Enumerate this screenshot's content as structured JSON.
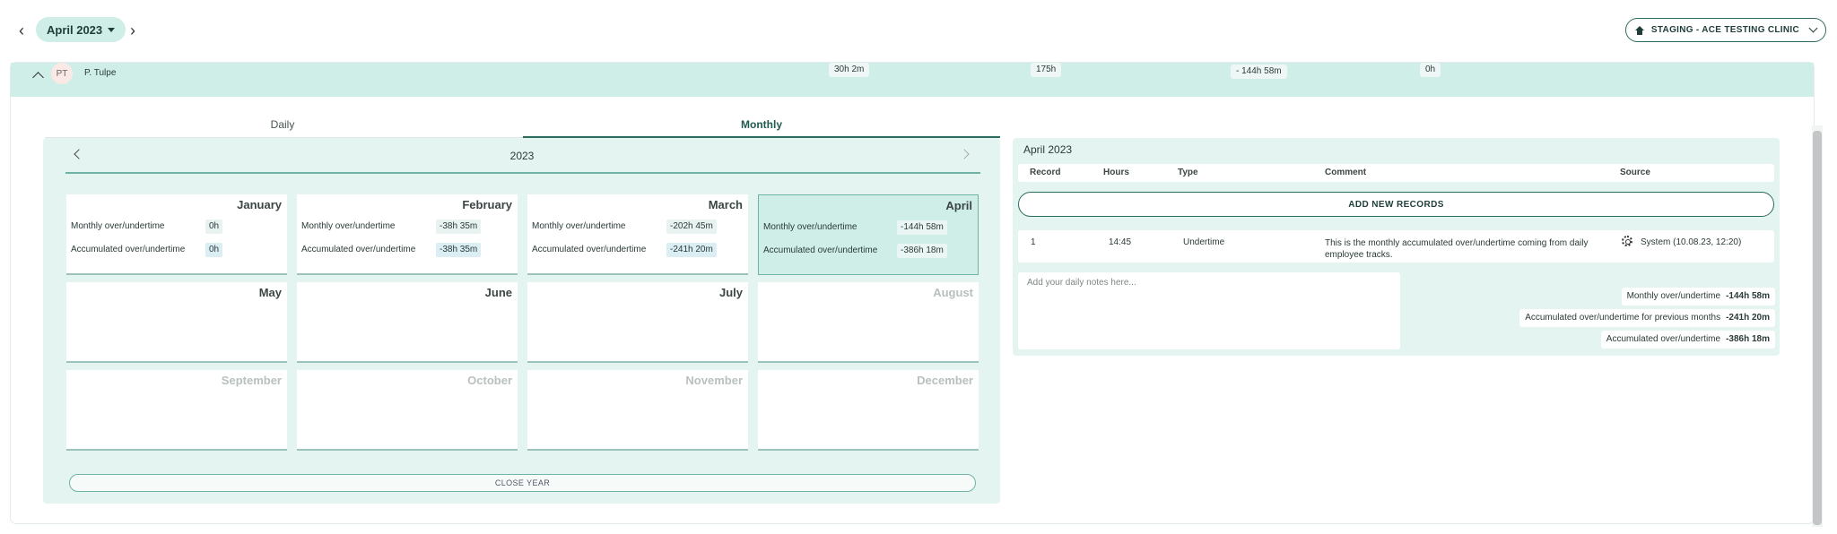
{
  "topbar": {
    "month_label": "April 2023",
    "clinic_label": "STAGING - ACE TESTING CLINIC"
  },
  "person": {
    "initials": "PT",
    "name": "P. Tulpe",
    "stats": [
      "30h 2m",
      "175h",
      "- 144h 58m",
      "0h"
    ]
  },
  "tabs": {
    "daily": "Daily",
    "monthly": "Monthly"
  },
  "year_view": {
    "year": "2023",
    "monthly_label": "Monthly over/undertime",
    "accum_label": "Accumulated over/undertime",
    "months": [
      {
        "name": "January",
        "monthly": "0h",
        "accum": "0h"
      },
      {
        "name": "February",
        "monthly": "-38h 35m",
        "accum": "-38h 35m"
      },
      {
        "name": "March",
        "monthly": "-202h 45m",
        "accum": "-241h 20m"
      },
      {
        "name": "April",
        "monthly": "-144h 58m",
        "accum": "-386h 18m"
      },
      {
        "name": "May"
      },
      {
        "name": "June"
      },
      {
        "name": "July"
      },
      {
        "name": "August"
      },
      {
        "name": "September"
      },
      {
        "name": "October"
      },
      {
        "name": "November"
      },
      {
        "name": "December"
      }
    ],
    "close_label": "CLOSE YEAR"
  },
  "records": {
    "title": "April 2023",
    "headers": {
      "record": "Record",
      "hours": "Hours",
      "type": "Type",
      "comment": "Comment",
      "source": "Source"
    },
    "add_label": "ADD NEW RECORDS",
    "row": {
      "record": "1",
      "hours": "14:45",
      "type": "Undertime",
      "comment": "This is the monthly accumulated over/undertime  coming from daily employee tracks.",
      "source": "System (10.08.23, 12:20)"
    },
    "notes_placeholder": "Add your daily notes here...",
    "summary": {
      "monthly_label": "Monthly over/undertime",
      "monthly_value": "-144h 58m",
      "prev_label": "Accumulated over/undertime for previous months",
      "prev_value": "-241h 20m",
      "accum_label": "Accumulated over/undertime",
      "accum_value": "-386h 18m"
    }
  },
  "colors": {
    "accent": "#2d6b5f",
    "panel": "#e4f5f1",
    "highlight": "#cfeee8"
  }
}
